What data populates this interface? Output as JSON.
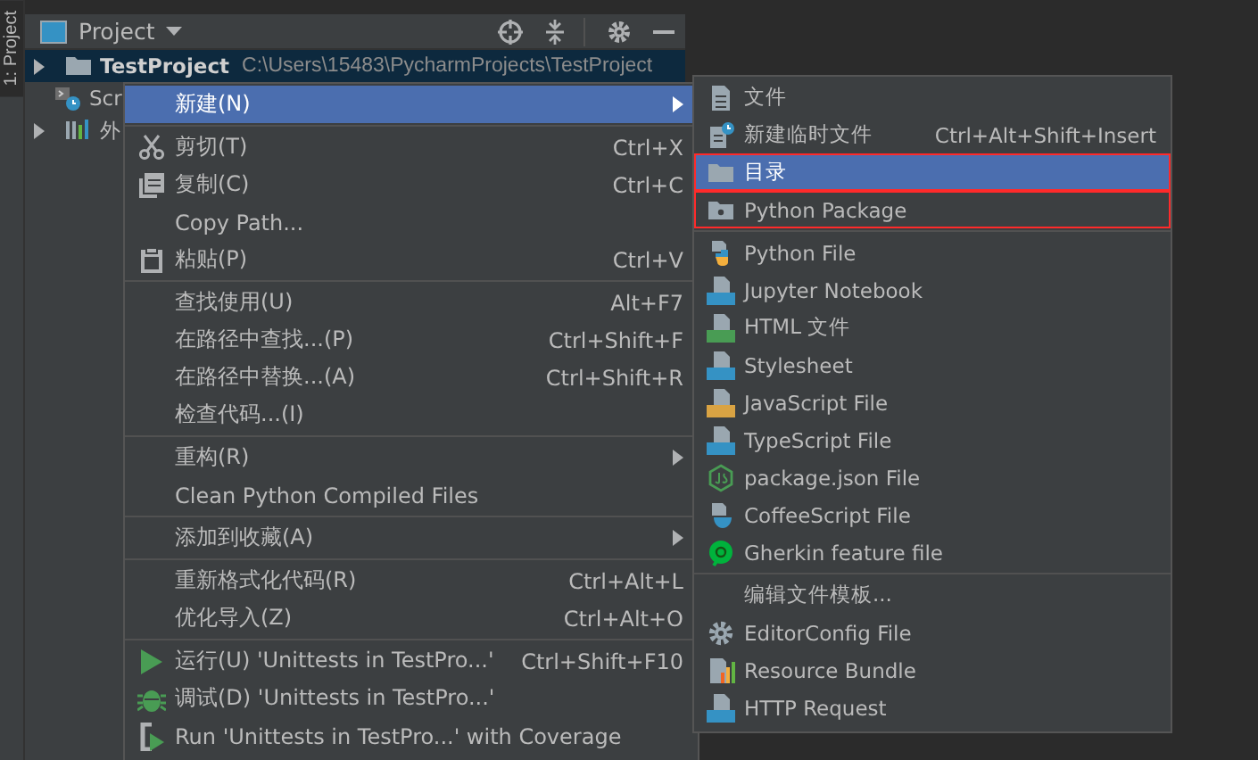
{
  "side_tab": {
    "label": "1: Project",
    "selected": true
  },
  "panel": {
    "title": "Project"
  },
  "tree": [
    {
      "label": "TestProject",
      "path": "C:\\Users\\15483\\PycharmProjects\\TestProject",
      "kind": "folder",
      "expanded": false,
      "selected": true
    },
    {
      "label": "Scr",
      "kind": "scratch",
      "selected": false
    },
    {
      "label": "外",
      "kind": "library",
      "expanded": false,
      "selected": false
    }
  ],
  "context_menu": {
    "groups": [
      [
        {
          "label": "新建(N)",
          "submenu": true,
          "selected": true
        }
      ],
      [
        {
          "label": "剪切(T)",
          "shortcut": "Ctrl+X",
          "kind": "cut",
          "selected": false
        },
        {
          "label": "复制(C)",
          "shortcut": "Ctrl+C",
          "kind": "copy",
          "selected": false
        },
        {
          "label": "Copy Path...",
          "selected": false
        },
        {
          "label": "粘贴(P)",
          "shortcut": "Ctrl+V",
          "kind": "paste",
          "selected": false
        }
      ],
      [
        {
          "label": "查找使用(U)",
          "shortcut": "Alt+F7",
          "selected": false
        },
        {
          "label": "在路径中查找...(P)",
          "shortcut": "Ctrl+Shift+F",
          "selected": false
        },
        {
          "label": "在路径中替换...(A)",
          "shortcut": "Ctrl+Shift+R",
          "selected": false
        },
        {
          "label": "检查代码...(I)",
          "selected": false
        }
      ],
      [
        {
          "label": "重构(R)",
          "submenu": true,
          "selected": false
        },
        {
          "label": "Clean Python Compiled Files",
          "selected": false
        }
      ],
      [
        {
          "label": "添加到收藏(A)",
          "submenu": true,
          "selected": false
        }
      ],
      [
        {
          "label": "重新格式化代码(R)",
          "shortcut": "Ctrl+Alt+L",
          "selected": false
        },
        {
          "label": "优化导入(Z)",
          "shortcut": "Ctrl+Alt+O",
          "selected": false
        }
      ],
      [
        {
          "label": "运行(U) 'Unittests in TestPro...'",
          "shortcut": "Ctrl+Shift+F10",
          "kind": "run",
          "selected": false
        },
        {
          "label": "调试(D) 'Unittests in TestPro...'",
          "kind": "debug",
          "selected": false
        },
        {
          "label": "Run 'Unittests in TestPro...' with Coverage",
          "kind": "coverage",
          "selected": false
        }
      ]
    ]
  },
  "new_submenu": {
    "groups": [
      [
        {
          "label": "文件",
          "kind": "file",
          "selected": false,
          "outlined": false
        },
        {
          "label": "新建临时文件",
          "shortcut": "Ctrl+Alt+Shift+Insert",
          "kind": "scratch-file",
          "selected": false,
          "outlined": false
        },
        {
          "label": "目录",
          "kind": "folder",
          "selected": true,
          "outlined": true
        },
        {
          "label": "Python Package",
          "kind": "package",
          "selected": false,
          "outlined": true
        }
      ],
      [
        {
          "label": "Python File",
          "kind": "python",
          "selected": false,
          "outlined": false
        },
        {
          "label": "Jupyter Notebook",
          "kind": "badge",
          "color": "#3592c4",
          "selected": false,
          "outlined": false
        },
        {
          "label": "HTML 文件",
          "kind": "badge",
          "color": "#499c54",
          "selected": false,
          "outlined": false
        },
        {
          "label": "Stylesheet",
          "kind": "badge",
          "color": "#3592c4",
          "selected": false,
          "outlined": false
        },
        {
          "label": "JavaScript File",
          "kind": "badge",
          "color": "#d9a343",
          "selected": false,
          "outlined": false
        },
        {
          "label": "TypeScript File",
          "kind": "badge",
          "color": "#3592c4",
          "selected": false,
          "outlined": false
        },
        {
          "label": "package.json File",
          "kind": "node",
          "selected": false,
          "outlined": false
        },
        {
          "label": "CoffeeScript File",
          "kind": "coffee",
          "selected": false,
          "outlined": false
        },
        {
          "label": "Gherkin feature file",
          "kind": "gherkin",
          "selected": false,
          "outlined": false
        }
      ],
      [
        {
          "label": "编辑文件模板...",
          "selected": false,
          "outlined": false
        },
        {
          "label": "EditorConfig File",
          "kind": "gear",
          "selected": false,
          "outlined": false
        },
        {
          "label": "Resource Bundle",
          "kind": "bundle",
          "selected": false,
          "outlined": false
        },
        {
          "label": "HTTP Request",
          "kind": "badge",
          "color": "#3592c4",
          "selected": false,
          "outlined": false
        }
      ]
    ]
  }
}
